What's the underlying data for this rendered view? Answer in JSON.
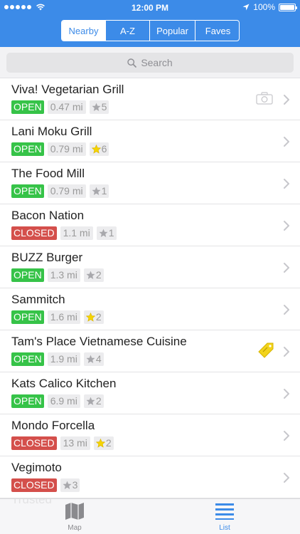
{
  "status": {
    "time": "12:00 PM",
    "battery": "100%"
  },
  "segments": [
    {
      "label": "Nearby",
      "active": true
    },
    {
      "label": "A-Z",
      "active": false
    },
    {
      "label": "Popular",
      "active": false
    },
    {
      "label": "Faves",
      "active": false
    }
  ],
  "search": {
    "placeholder": "Search"
  },
  "restaurants": [
    {
      "name": "Viva! Vegetarian Grill",
      "status": "OPEN",
      "distance": "0.47 mi",
      "rating": "5",
      "favorite": false,
      "extra_icon": "camera-icon"
    },
    {
      "name": "Lani Moku Grill",
      "status": "OPEN",
      "distance": "0.79 mi",
      "rating": "6",
      "favorite": true,
      "extra_icon": ""
    },
    {
      "name": "The Food Mill",
      "status": "OPEN",
      "distance": "0.79 mi",
      "rating": "1",
      "favorite": false,
      "extra_icon": ""
    },
    {
      "name": "Bacon Nation",
      "status": "CLOSED",
      "distance": "1.1 mi",
      "rating": "1",
      "favorite": false,
      "extra_icon": ""
    },
    {
      "name": "BUZZ Burger",
      "status": "OPEN",
      "distance": "1.3 mi",
      "rating": "2",
      "favorite": false,
      "extra_icon": ""
    },
    {
      "name": "Sammitch",
      "status": "OPEN",
      "distance": "1.6 mi",
      "rating": "2",
      "favorite": true,
      "extra_icon": ""
    },
    {
      "name": "Tam's Place Vietnamese Cuisine",
      "status": "OPEN",
      "distance": "1.9 mi",
      "rating": "4",
      "favorite": false,
      "extra_icon": "price-tag-icon"
    },
    {
      "name": "Kats Calico Kitchen",
      "status": "OPEN",
      "distance": "6.9 mi",
      "rating": "2",
      "favorite": false,
      "extra_icon": ""
    },
    {
      "name": "Mondo Forcella",
      "status": "CLOSED",
      "distance": "13 mi",
      "rating": "2",
      "favorite": true,
      "extra_icon": ""
    },
    {
      "name": "Vegimoto",
      "status": "CLOSED",
      "distance": "",
      "rating": "3",
      "favorite": false,
      "extra_icon": ""
    }
  ],
  "partial_row": {
    "name": "Trusted"
  },
  "tabbar": [
    {
      "label": "Map",
      "icon": "map-icon",
      "active": false
    },
    {
      "label": "List",
      "icon": "list-icon",
      "active": true
    }
  ],
  "colors": {
    "header": "#3c8be8",
    "open": "#36c348",
    "closed": "#d44f4b",
    "star_fav": "#f5d400"
  }
}
